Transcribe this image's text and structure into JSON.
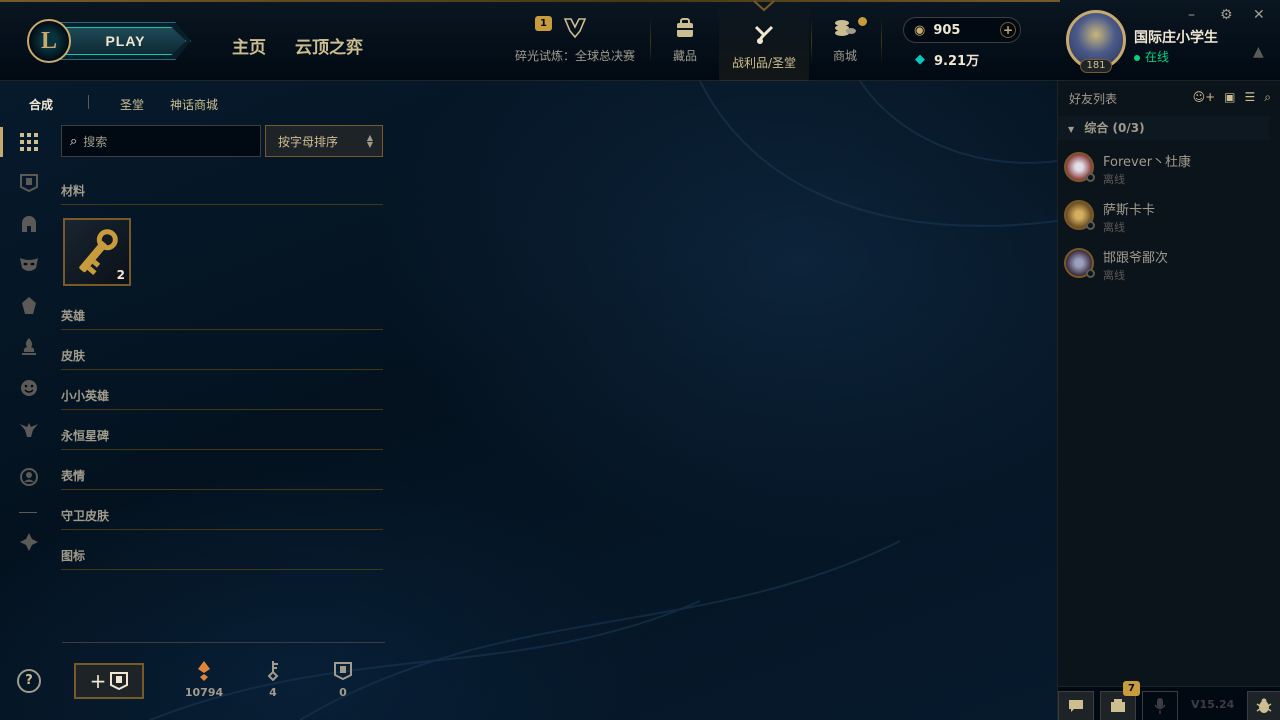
{
  "header": {
    "play_label": "PLAY",
    "nav_home": "主页",
    "nav_tft": "云顶之弈",
    "event_badge": "1",
    "event_label": "碎光试炼：全球总决赛",
    "collection_label": "藏品",
    "loot_label": "战利品/圣堂",
    "store_label": "商城",
    "rp_amount": "905",
    "be_amount": "9.21万",
    "profile_level": "181",
    "profile_name": "国际庄小学生",
    "profile_status": "在线"
  },
  "loot": {
    "tab_craft": "合成",
    "tab_sanctum": "圣堂",
    "tab_mythic": "神话商城",
    "search_placeholder": "搜索",
    "sort_label": "按字母排序",
    "categories": [
      "材料",
      "英雄",
      "皮肤",
      "小小英雄",
      "永恒星碑",
      "表情",
      "守卫皮肤",
      "图标"
    ],
    "key_fragment_count": "2",
    "orange_essence": "10794",
    "keys": "4",
    "chests": "0"
  },
  "friends": {
    "title": "好友列表",
    "group_label": "综合 (0/3)",
    "list": [
      {
        "name": "Forever丶杜康",
        "status": "离线"
      },
      {
        "name": "萨斯卡卡",
        "status": "离线"
      },
      {
        "name": "邯跟爷鄙次",
        "status": "离线"
      }
    ],
    "notif_count": "7",
    "version": "V15.24"
  },
  "colors": {
    "gold": "#c8aa6e",
    "gold_dark": "#785a28",
    "teal": "#0ac8b9",
    "online": "#0acf83",
    "background": "#010a13"
  }
}
